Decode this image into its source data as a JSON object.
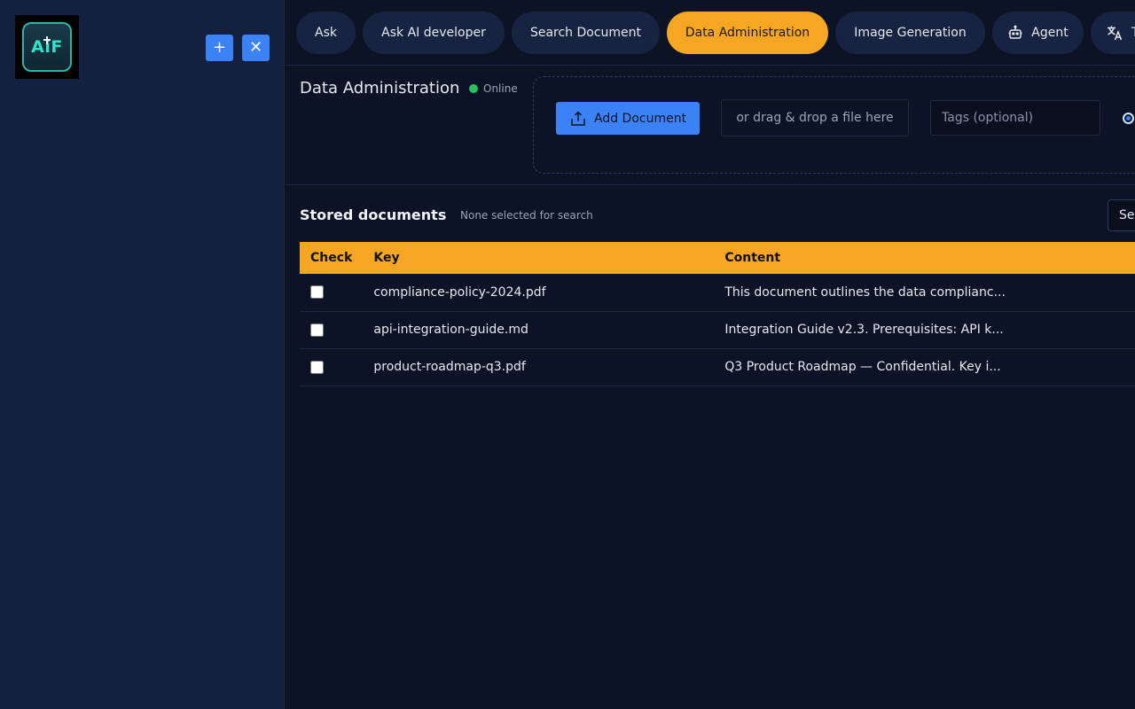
{
  "sidebar": {
    "logo_text": "AiF",
    "new_button_label": "+",
    "close_button_label": "✕"
  },
  "tabs": [
    {
      "label": "Ask",
      "active": false
    },
    {
      "label": "Ask AI developer",
      "active": false
    },
    {
      "label": "Search Document",
      "active": false
    },
    {
      "label": "Data Administration",
      "active": true
    },
    {
      "label": "Image Generation",
      "active": false
    },
    {
      "label": "Agent",
      "active": false,
      "icon": "robot-icon"
    },
    {
      "label": "T",
      "active": false,
      "icon": "translate-icon"
    }
  ],
  "header": {
    "title": "Data Administration",
    "status": "Online"
  },
  "upload": {
    "add_button_label": "Add Document",
    "drop_hint": "or drag & drop a file here",
    "tags_placeholder": "Tags (optional)"
  },
  "documents": {
    "title": "Stored documents",
    "selection_status": "None selected for search",
    "select_button_label": "Se",
    "columns": [
      "Check",
      "Key",
      "Content"
    ],
    "rows": [
      {
        "key": "compliance-policy-2024.pdf",
        "content": "This document outlines the data complianc...",
        "checked": false
      },
      {
        "key": "api-integration-guide.md",
        "content": "Integration Guide v2.3. Prerequisites: API k...",
        "checked": false
      },
      {
        "key": "product-roadmap-q3.pdf",
        "content": "Q3 Product Roadmap — Confidential. Key i...",
        "checked": false
      }
    ]
  },
  "colors": {
    "accent": "#f6a623",
    "primary": "#3b82f6",
    "sidebar_bg": "#142040",
    "main_bg": "#0c1325",
    "status_online": "#22c55e"
  }
}
